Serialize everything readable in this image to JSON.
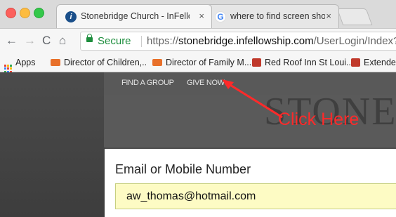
{
  "browser": {
    "tabs": [
      {
        "title": "Stonebridge Church - InFellow",
        "favicon": "infellowship-icon",
        "active": true
      },
      {
        "title": "where to find screen shot on m",
        "favicon": "google-icon",
        "active": false
      }
    ],
    "tab_close_glyph": "×",
    "favicon_text": {
      "infellowship": "i",
      "google": "G"
    },
    "address": {
      "secure_label": "Secure",
      "url_scheme": "https://",
      "url_host": "stonebridge.infellowship.com",
      "url_path": "/UserLogin/Index?Return"
    },
    "nav_glyphs": {
      "back": "←",
      "forward": "→",
      "reload": "C",
      "home": "⌂"
    },
    "bookmarks": [
      {
        "label": "Apps",
        "icon": "apps-grid-icon"
      },
      {
        "label": "Director of Children,..",
        "icon": "briefcase-icon"
      },
      {
        "label": "Director of Family M...",
        "icon": "briefcase-icon"
      },
      {
        "label": "Red Roof Inn St Loui...",
        "icon": "red-roof-icon"
      },
      {
        "label": "Extende",
        "icon": "red-roof-icon"
      }
    ]
  },
  "site": {
    "nav": [
      {
        "label": "FIND A GROUP"
      },
      {
        "label": "GIVE NOW"
      }
    ],
    "hero_text": "STONE",
    "annotation": {
      "text": "Click Here",
      "color": "#ff2a2a"
    },
    "login": {
      "label": "Email or Mobile Number",
      "value": "aw_thomas@hotmail.com"
    }
  }
}
